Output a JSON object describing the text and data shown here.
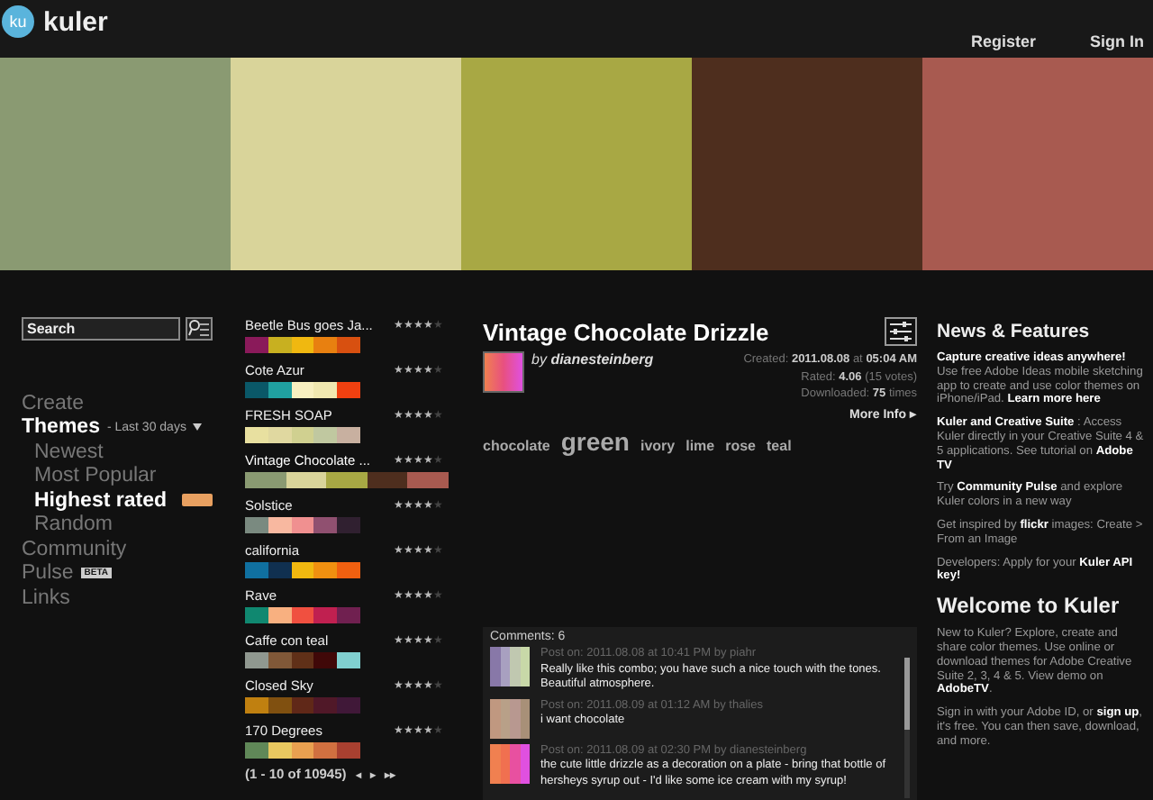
{
  "header": {
    "logo_mark": "ku",
    "logo_text": "kuler",
    "links": [
      "Register",
      "Sign In"
    ]
  },
  "palette": [
    {
      "color": "#8a9a72"
    },
    {
      "color": "#d9d49a"
    },
    {
      "color": "#a8a844"
    },
    {
      "color": "#4e2e1e"
    },
    {
      "color": "#a85a50"
    }
  ],
  "search": {
    "placeholder": "Search"
  },
  "nav": [
    {
      "label": "Create",
      "selected": false
    },
    {
      "label": "Themes",
      "selected": true,
      "filter": "- Last 30 days",
      "children": [
        {
          "label": "Newest",
          "selected": false
        },
        {
          "label": "Most Popular",
          "selected": false
        },
        {
          "label": "Highest rated",
          "selected": true,
          "badge": true
        },
        {
          "label": "Random",
          "selected": false
        }
      ]
    },
    {
      "label": "Community",
      "selected": false
    },
    {
      "label": "Pulse",
      "selected": false,
      "badge_text": "BETA"
    },
    {
      "label": "Links",
      "selected": false
    }
  ],
  "themes": [
    {
      "name": "Beetle Bus goes Ja...",
      "stars": 4,
      "selected": false,
      "colors": [
        {
          "color": "#8a1a5a"
        },
        {
          "color": "#c8b020"
        },
        {
          "color": "#f0b810"
        },
        {
          "color": "#e88010"
        },
        {
          "color": "#d85010"
        }
      ]
    },
    {
      "name": "Cote Azur",
      "stars": 4,
      "selected": false,
      "colors": [
        {
          "color": "#0a5868"
        },
        {
          "color": "#20a0a0"
        },
        {
          "color": "#f8f0c0"
        },
        {
          "color": "#f0e8b0"
        },
        {
          "color": "#f04010"
        }
      ]
    },
    {
      "name": "FRESH SOAP",
      "stars": 4,
      "selected": false,
      "colors": [
        {
          "color": "#e8e0a0"
        },
        {
          "color": "#e0d8a0"
        },
        {
          "color": "#d0d090"
        },
        {
          "color": "#c0c8a0"
        },
        {
          "color": "#c8b0a0"
        }
      ]
    },
    {
      "name": "Vintage Chocolate ...",
      "stars": 4,
      "selected": true,
      "colors": [
        {
          "color": "#8a9a72"
        },
        {
          "color": "#d9d49a"
        },
        {
          "color": "#a8a844"
        },
        {
          "color": "#4e2e1e"
        },
        {
          "color": "#a85a50"
        }
      ]
    },
    {
      "name": "Solstice",
      "stars": 4,
      "selected": false,
      "colors": [
        {
          "color": "#7a8a80"
        },
        {
          "color": "#f8b8a0"
        },
        {
          "color": "#f09090"
        },
        {
          "color": "#905070"
        },
        {
          "color": "#302030"
        }
      ]
    },
    {
      "name": "california",
      "stars": 4,
      "selected": false,
      "colors": [
        {
          "color": "#1070a0"
        },
        {
          "color": "#103050"
        },
        {
          "color": "#f0b810"
        },
        {
          "color": "#f09010"
        },
        {
          "color": "#f06010"
        }
      ]
    },
    {
      "name": "Rave",
      "stars": 4,
      "selected": false,
      "colors": [
        {
          "color": "#108870"
        },
        {
          "color": "#f8b080"
        },
        {
          "color": "#f05040"
        },
        {
          "color": "#c02050"
        },
        {
          "color": "#702050"
        }
      ]
    },
    {
      "name": "Caffe con teal",
      "stars": 4,
      "selected": false,
      "colors": [
        {
          "color": "#909890"
        },
        {
          "color": "#805838"
        },
        {
          "color": "#603018"
        },
        {
          "color": "#400808"
        },
        {
          "color": "#80d0d0"
        }
      ]
    },
    {
      "name": "Closed Sky",
      "stars": 4,
      "selected": false,
      "colors": [
        {
          "color": "#c08010"
        },
        {
          "color": "#805010"
        },
        {
          "color": "#602818"
        },
        {
          "color": "#501828"
        },
        {
          "color": "#401838"
        }
      ]
    },
    {
      "name": "170 Degrees",
      "stars": 4,
      "selected": false,
      "colors": [
        {
          "color": "#608858"
        },
        {
          "color": "#e8c860"
        },
        {
          "color": "#e8a050"
        },
        {
          "color": "#d07040"
        },
        {
          "color": "#a84030"
        }
      ]
    }
  ],
  "pager": {
    "text": "(1 - 10 of 10945)",
    "controls": [
      "◂",
      "▸",
      "▸▸"
    ]
  },
  "detail": {
    "title": "Vintage Chocolate Drizzle",
    "by": "by",
    "author": "dianesteinberg",
    "meta": [
      "Created: **2011.08.08** at **05:04 AM**",
      "Rated: **4.06** (15 votes)",
      "Downloaded: **75** times"
    ],
    "more": "More Info",
    "more_icon": "▸",
    "tags": [
      {
        "text": "chocolate",
        "kind": "normal"
      },
      {
        "text": "green",
        "kind": "large"
      },
      {
        "text": "ivory",
        "kind": "normal"
      },
      {
        "text": "lime",
        "kind": "normal"
      },
      {
        "text": "rose",
        "kind": "normal"
      },
      {
        "text": "teal",
        "kind": "normal"
      }
    ]
  },
  "comments": {
    "title": "Comments: 6",
    "items": [
      {
        "meta": "Post on: 2011.08.08 at 10:41 PM by piahr",
        "text": "Really like this combo; you have such a nice touch with the tones. Beautiful atmosphere.",
        "colors": [
          {
            "color": "#8878a8"
          },
          {
            "color": "#a8a0c0"
          },
          {
            "color": "#c0c8b0"
          },
          {
            "color": "#c8d8a8"
          }
        ]
      },
      {
        "meta": "Post on: 2011.08.09 at 01:12 AM by thalies",
        "text": "i want chocolate",
        "colors": [
          {
            "color": "#c09880"
          },
          {
            "color": "#b8a088"
          },
          {
            "color": "#b89890"
          },
          {
            "color": "#a89078"
          }
        ]
      },
      {
        "meta": "Post on: 2011.08.09 at 02:30 PM by dianesteinberg",
        "text": "the cute little drizzle as a decoration on a plate - bring that bottle of hersheys syrup out - I'd like some ice cream with my syrup!",
        "colors": [
          {
            "color": "#f08050"
          },
          {
            "color": "#f07050"
          },
          {
            "color": "#e850a0"
          },
          {
            "color": "#e050e0"
          }
        ]
      }
    ]
  },
  "news": {
    "title": "News & Features",
    "paragraphs": [
      "**Capture creative ideas anywhere!** Use free Adobe Ideas mobile sketching app to create and use color themes on iPhone/iPad. **Learn more here**",
      "**Kuler and Creative Suite** : Access Kuler directly in your Creative Suite 4 & 5 applications. See tutorial on **Adobe TV**",
      "Try **Community Pulse** and explore Kuler colors in a new way",
      "Get inspired by **flickr** images: Create > From an Image",
      "Developers: Apply for your **Kuler API key!**"
    ]
  },
  "welcome": {
    "title": "Welcome to Kuler",
    "paragraphs": [
      "New to Kuler? Explore, create and share color themes. Use online or download themes for Adobe Creative Suite 2, 3, 4 & 5. View demo on **AdobeTV**.",
      "Sign in with your Adobe ID, or **sign up**, it's free. You can then save, download, and more."
    ]
  }
}
